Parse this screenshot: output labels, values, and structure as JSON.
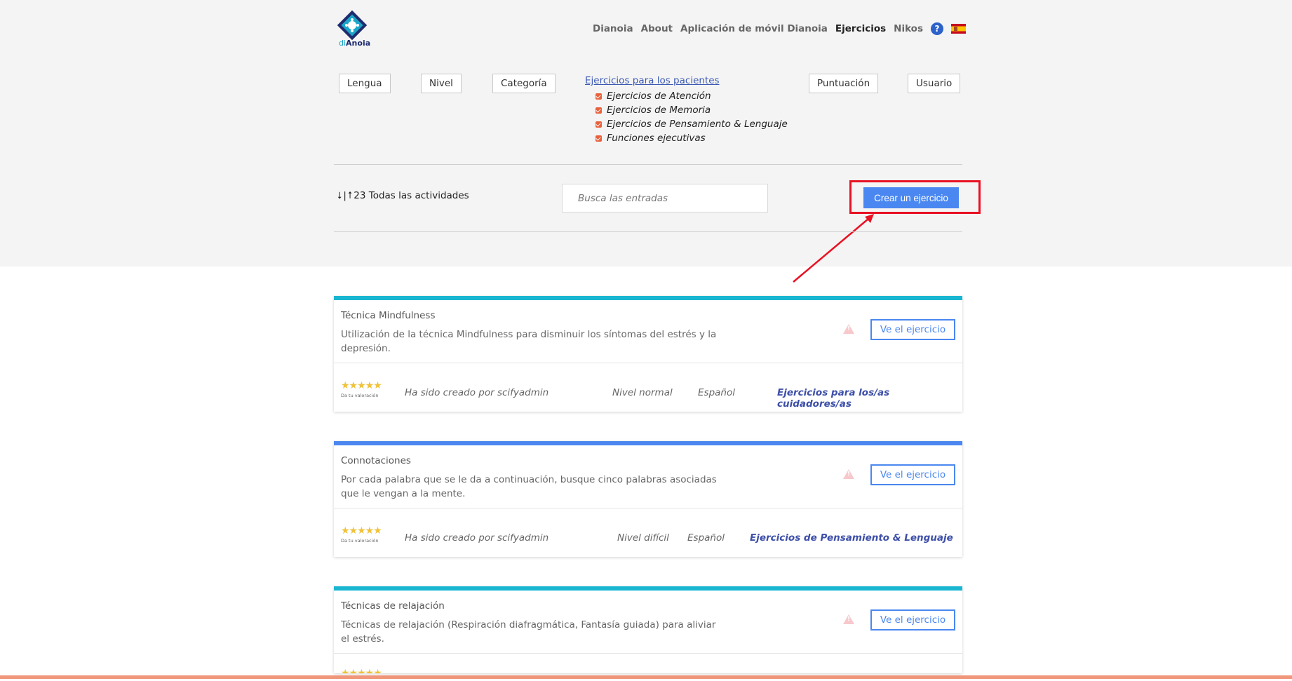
{
  "header": {
    "logo_text_prefix": "di",
    "logo_text_main": "Anoia",
    "nav": [
      {
        "label": "Dianoia",
        "active": false
      },
      {
        "label": "About",
        "active": false
      },
      {
        "label": "Aplicación de móvil Dianoia",
        "active": false
      },
      {
        "label": "Ejercicios",
        "active": true
      },
      {
        "label": "Nikos",
        "active": false
      }
    ],
    "help_symbol": "?",
    "language_icon": "spain-flag-icon"
  },
  "filters": {
    "language": "Lengua",
    "level": "Nivel",
    "category": "Categoría",
    "rating": "Puntuación",
    "user": "Usuario",
    "category_group_link": "Ejercicios para los pacientes",
    "category_options": [
      "Ejercicios de Atención",
      "Ejercicios de Memoria",
      "Ejercicios de Pensamiento & Lenguaje",
      "Funciones ejecutivas"
    ]
  },
  "toolbar": {
    "sort_down": "⭣",
    "sort_sep": "|",
    "sort_up": "⭡",
    "count_text": "23 Todas las actividades",
    "search_placeholder": "Busca las entradas",
    "create_button": "Crear un ejercicio"
  },
  "colors": {
    "accent": "#4a87f0",
    "highlight": "#e81123",
    "card_teal": "#19b6d1",
    "card_blue": "#4a87f0"
  },
  "exercises": [
    {
      "title": "Técnica Mindfulness",
      "description": "Utilización de la técnica Mindfulness para disminuir los síntomas del estrés y la depresión.",
      "view_button": "Ve el ejercicio",
      "stars": "★★★★★",
      "rating_label": "Da tu valoración",
      "created_by": "Ha sido creado por scifyadmin",
      "level": "Nivel normal",
      "language": "Español",
      "category": "Ejercicios para los/as cuidadores/as"
    },
    {
      "title": "Connotaciones",
      "description": "Por cada palabra que se le da a continuación, busque cinco palabras asociadas que le vengan a la mente.",
      "view_button": "Ve el ejercicio",
      "stars": "★★★★★",
      "rating_label": "Da tu valoración",
      "created_by": "Ha sido creado por scifyadmin",
      "level": "Nivel difícil",
      "language": "Español",
      "category": "Ejercicios de Pensamiento & Lenguaje"
    },
    {
      "title": "Técnicas de relajación",
      "description": "Técnicas de relajación (Respiración diafragmática, Fantasía guiada) para aliviar el estrés.",
      "view_button": "Ve el ejercicio",
      "stars": "★★★★★"
    }
  ]
}
